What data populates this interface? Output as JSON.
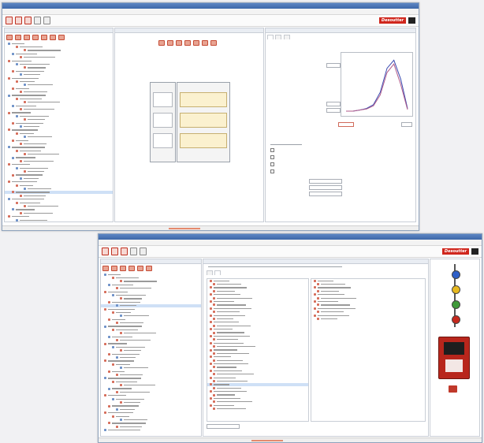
{
  "logo": "Desoutter",
  "window_top": {
    "menu": [],
    "tree_rows": 58,
    "selected_row": 43
  },
  "window_bottom": {
    "menu": [],
    "tree_rows": 46,
    "selected_row": 9
  },
  "colors": {
    "accent_red": "#d0271d",
    "titlebar_blue": "#4a74b3",
    "selection": "#cfe0f6",
    "task_yellow": "#fbf1cf",
    "stack_light_blue": "#2f60c8",
    "stack_light_yellow": "#e7b91f",
    "stack_light_green": "#3f9a3a",
    "stack_light_red": "#c6281d"
  },
  "icons": [
    "tool-icon",
    "controller-icon",
    "folder-icon",
    "gear-icon",
    "stack-light-icon",
    "help-icon"
  ],
  "chart_data": {
    "type": "line",
    "title": "",
    "xlabel": "",
    "ylabel": "",
    "series": [
      {
        "values": [
          0,
          0,
          0.02,
          0.05,
          0.12,
          0.35,
          0.8,
          0.95,
          0.6,
          0.05
        ]
      },
      {
        "values": [
          0,
          0,
          0.02,
          0.04,
          0.1,
          0.3,
          0.72,
          0.88,
          0.5,
          0.03
        ]
      }
    ]
  }
}
